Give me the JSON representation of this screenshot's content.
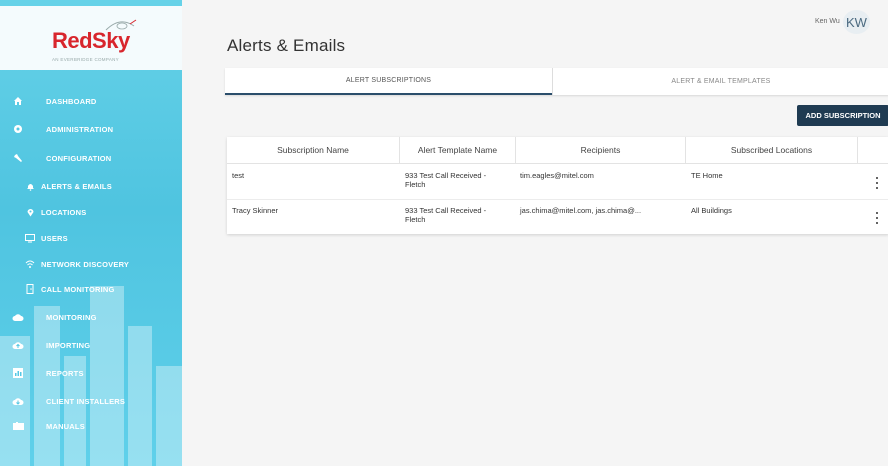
{
  "brand": {
    "logo_text": "RedSky",
    "logo_subtext": "AN EVERBRIDGE COMPANY",
    "accent": "#d8262d"
  },
  "sidebar": {
    "items": [
      {
        "label": "DASHBOARD",
        "icon": "home-icon"
      },
      {
        "label": "ADMINISTRATION",
        "icon": "gear-icon"
      },
      {
        "label": "CONFIGURATION",
        "icon": "wrench-icon"
      },
      {
        "label": "ALERTS & EMAILS",
        "icon": "bell-icon"
      },
      {
        "label": "LOCATIONS",
        "icon": "map-pin-icon"
      },
      {
        "label": "USERS",
        "icon": "monitor-icon"
      },
      {
        "label": "NETWORK DISCOVERY",
        "icon": "wifi-icon"
      },
      {
        "label": "CALL MONITORING",
        "icon": "door-icon"
      },
      {
        "label": "MONITORING",
        "icon": "cloud-icon"
      },
      {
        "label": "IMPORTING",
        "icon": "cloud-upload-icon"
      },
      {
        "label": "REPORTS",
        "icon": "chart-icon"
      },
      {
        "label": "CLIENT INSTALLERS",
        "icon": "cloud-download-icon"
      },
      {
        "label": "MANUALS",
        "icon": "book-icon"
      }
    ]
  },
  "header": {
    "title": "Alerts & Emails",
    "user_name": "Ken Wu",
    "avatar_initials": "KW"
  },
  "tabs": [
    {
      "label": "ALERT SUBSCRIPTIONS",
      "active": true
    },
    {
      "label": "ALERT & EMAIL TEMPLATES",
      "active": false
    }
  ],
  "actions": {
    "add_label": "ADD SUBSCRIPTION"
  },
  "table": {
    "columns": [
      "Subscription Name",
      "Alert Template Name",
      "Recipients",
      "Subscribed Locations"
    ],
    "rows": [
      {
        "name": "test",
        "template_line1": "933 Test Call Received -",
        "template_line2": "Fletch",
        "recipients": "tim.eagles@mitel.com",
        "locations": "TE Home"
      },
      {
        "name": "Tracy Skinner",
        "template_line1": "933 Test Call Received -",
        "template_line2": "Fletch",
        "recipients": "jas.chima@mitel.com, jas.chima@...",
        "locations": "All Buildings"
      }
    ]
  },
  "colors": {
    "sidebar": "#55c8e4",
    "button": "#1f3b52",
    "tab_underline": "#2b4e6b"
  }
}
